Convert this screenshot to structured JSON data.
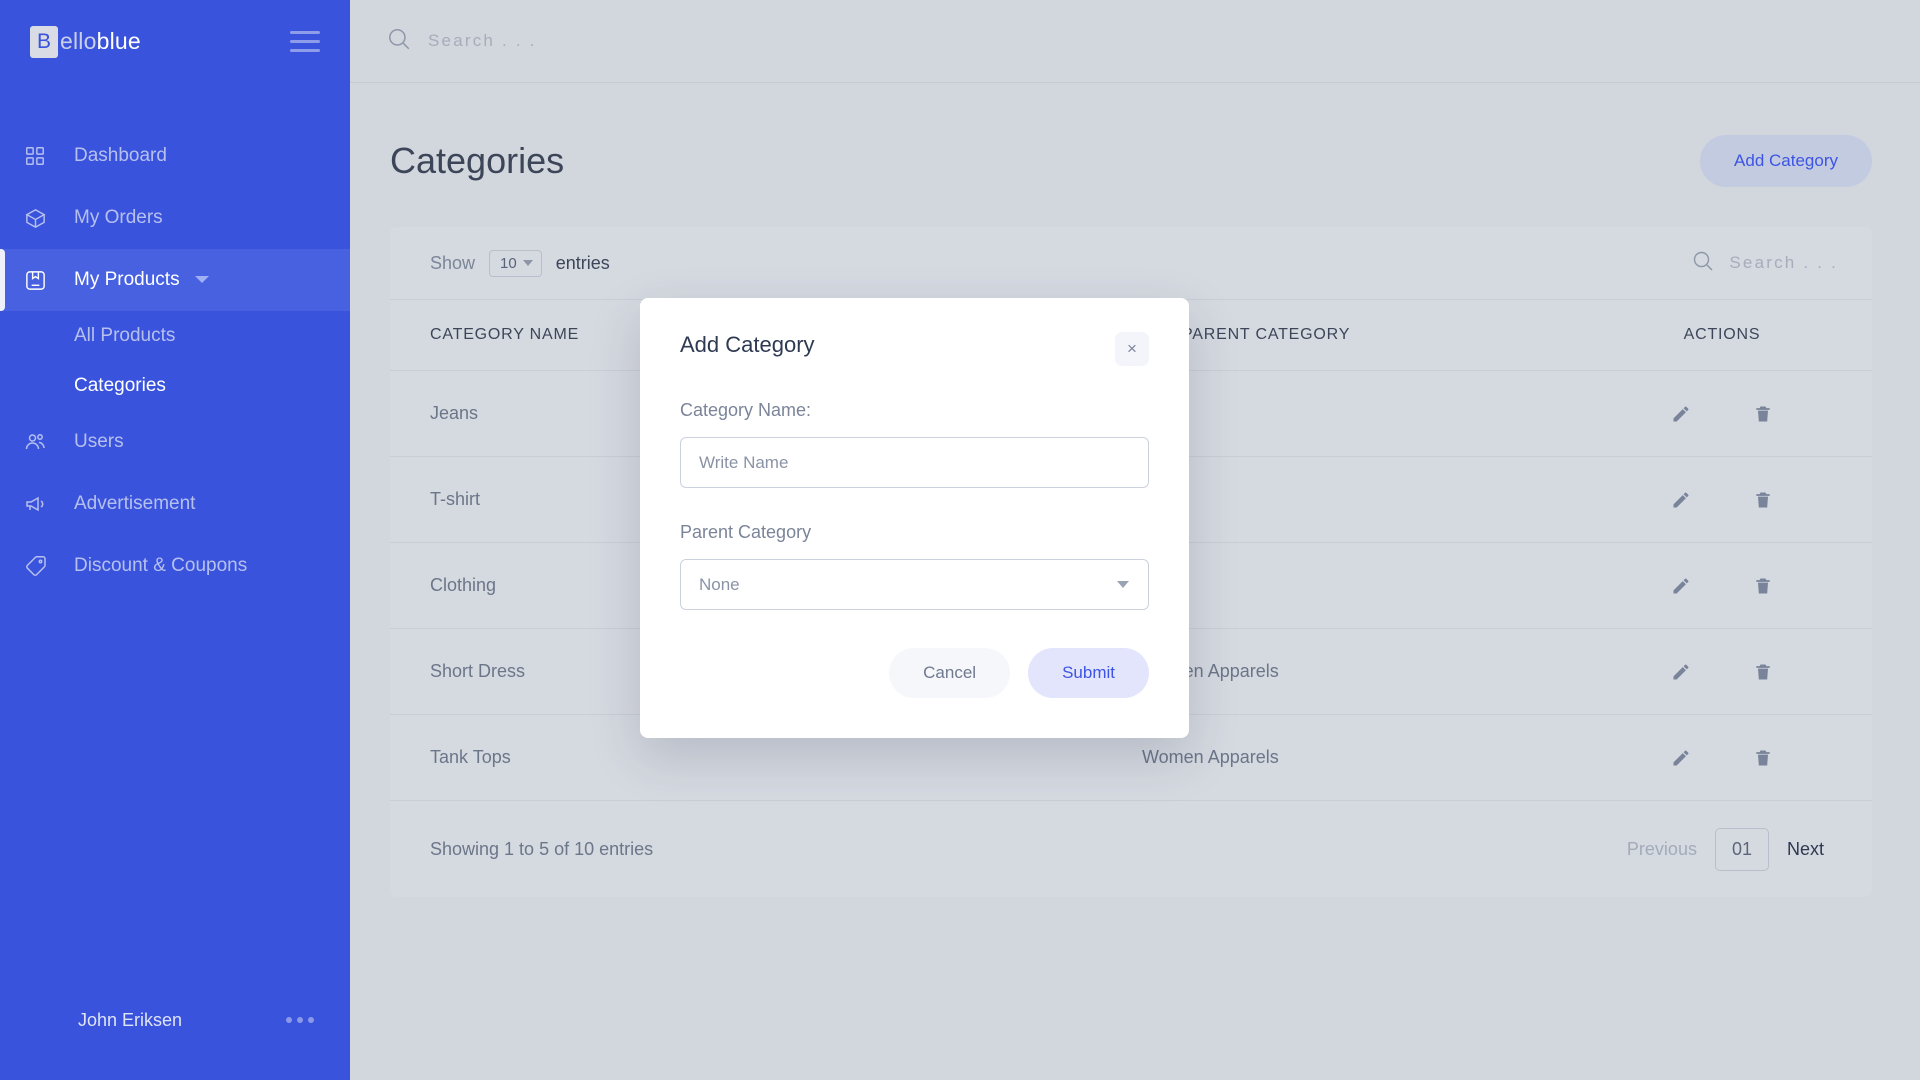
{
  "sidebar": {
    "brand": {
      "badge": "B",
      "rest_light": "ello",
      "rest_bold": "blue"
    },
    "items": [
      {
        "label": "Dashboard",
        "icon": "grid-icon"
      },
      {
        "label": "My Orders",
        "icon": "box-icon"
      },
      {
        "label": "My Products",
        "icon": "product-box-icon"
      },
      {
        "label": "Users",
        "icon": "users-icon"
      },
      {
        "label": "Advertisement",
        "icon": "megaphone-icon"
      },
      {
        "label": "Discount & Coupons",
        "icon": "tag-icon"
      }
    ],
    "sub_items": [
      {
        "label": "All Products"
      },
      {
        "label": "Categories"
      }
    ],
    "footer": {
      "user": "John Eriksen",
      "more": "more-options"
    }
  },
  "topbar": {
    "search_placeholder": "Search . . ."
  },
  "page": {
    "title": "Categories",
    "add_button": "Add Category"
  },
  "table_controls": {
    "show_label": "Show",
    "entries_label": "entries",
    "page_size": "10",
    "search_placeholder": "Search . . ."
  },
  "table": {
    "columns": [
      "CATEGORY NAME",
      "PARENT CATEGORY",
      "ACTIONS"
    ],
    "rows": [
      {
        "name": "Jeans",
        "parent": ""
      },
      {
        "name": "T-shirt",
        "parent": ""
      },
      {
        "name": "Clothing",
        "parent": ""
      },
      {
        "name": "Short Dress",
        "parent": "Women Apparels"
      },
      {
        "name": "Tank Tops",
        "parent": "Women Apparels"
      }
    ],
    "row_actions": {
      "edit": "edit-pencil-icon",
      "delete": "trash-icon"
    }
  },
  "footer": {
    "showing": "Showing 1 to 5 of 10 entries",
    "previous": "Previous",
    "page_number": "01",
    "next": "Next"
  },
  "modal": {
    "title": "Add Category",
    "close": "×",
    "name_label": "Category Name:",
    "name_placeholder": "Write Name",
    "parent_label": "Parent Category",
    "parent_value": "None",
    "cancel": "Cancel",
    "submit": "Submit"
  },
  "colors": {
    "sidebar": "#3A53DC",
    "sidebar_active": "#4761E0",
    "accent": "#3d54e4",
    "page_bg": "#d2d6dd",
    "card_bg": "#d5d9e0"
  }
}
